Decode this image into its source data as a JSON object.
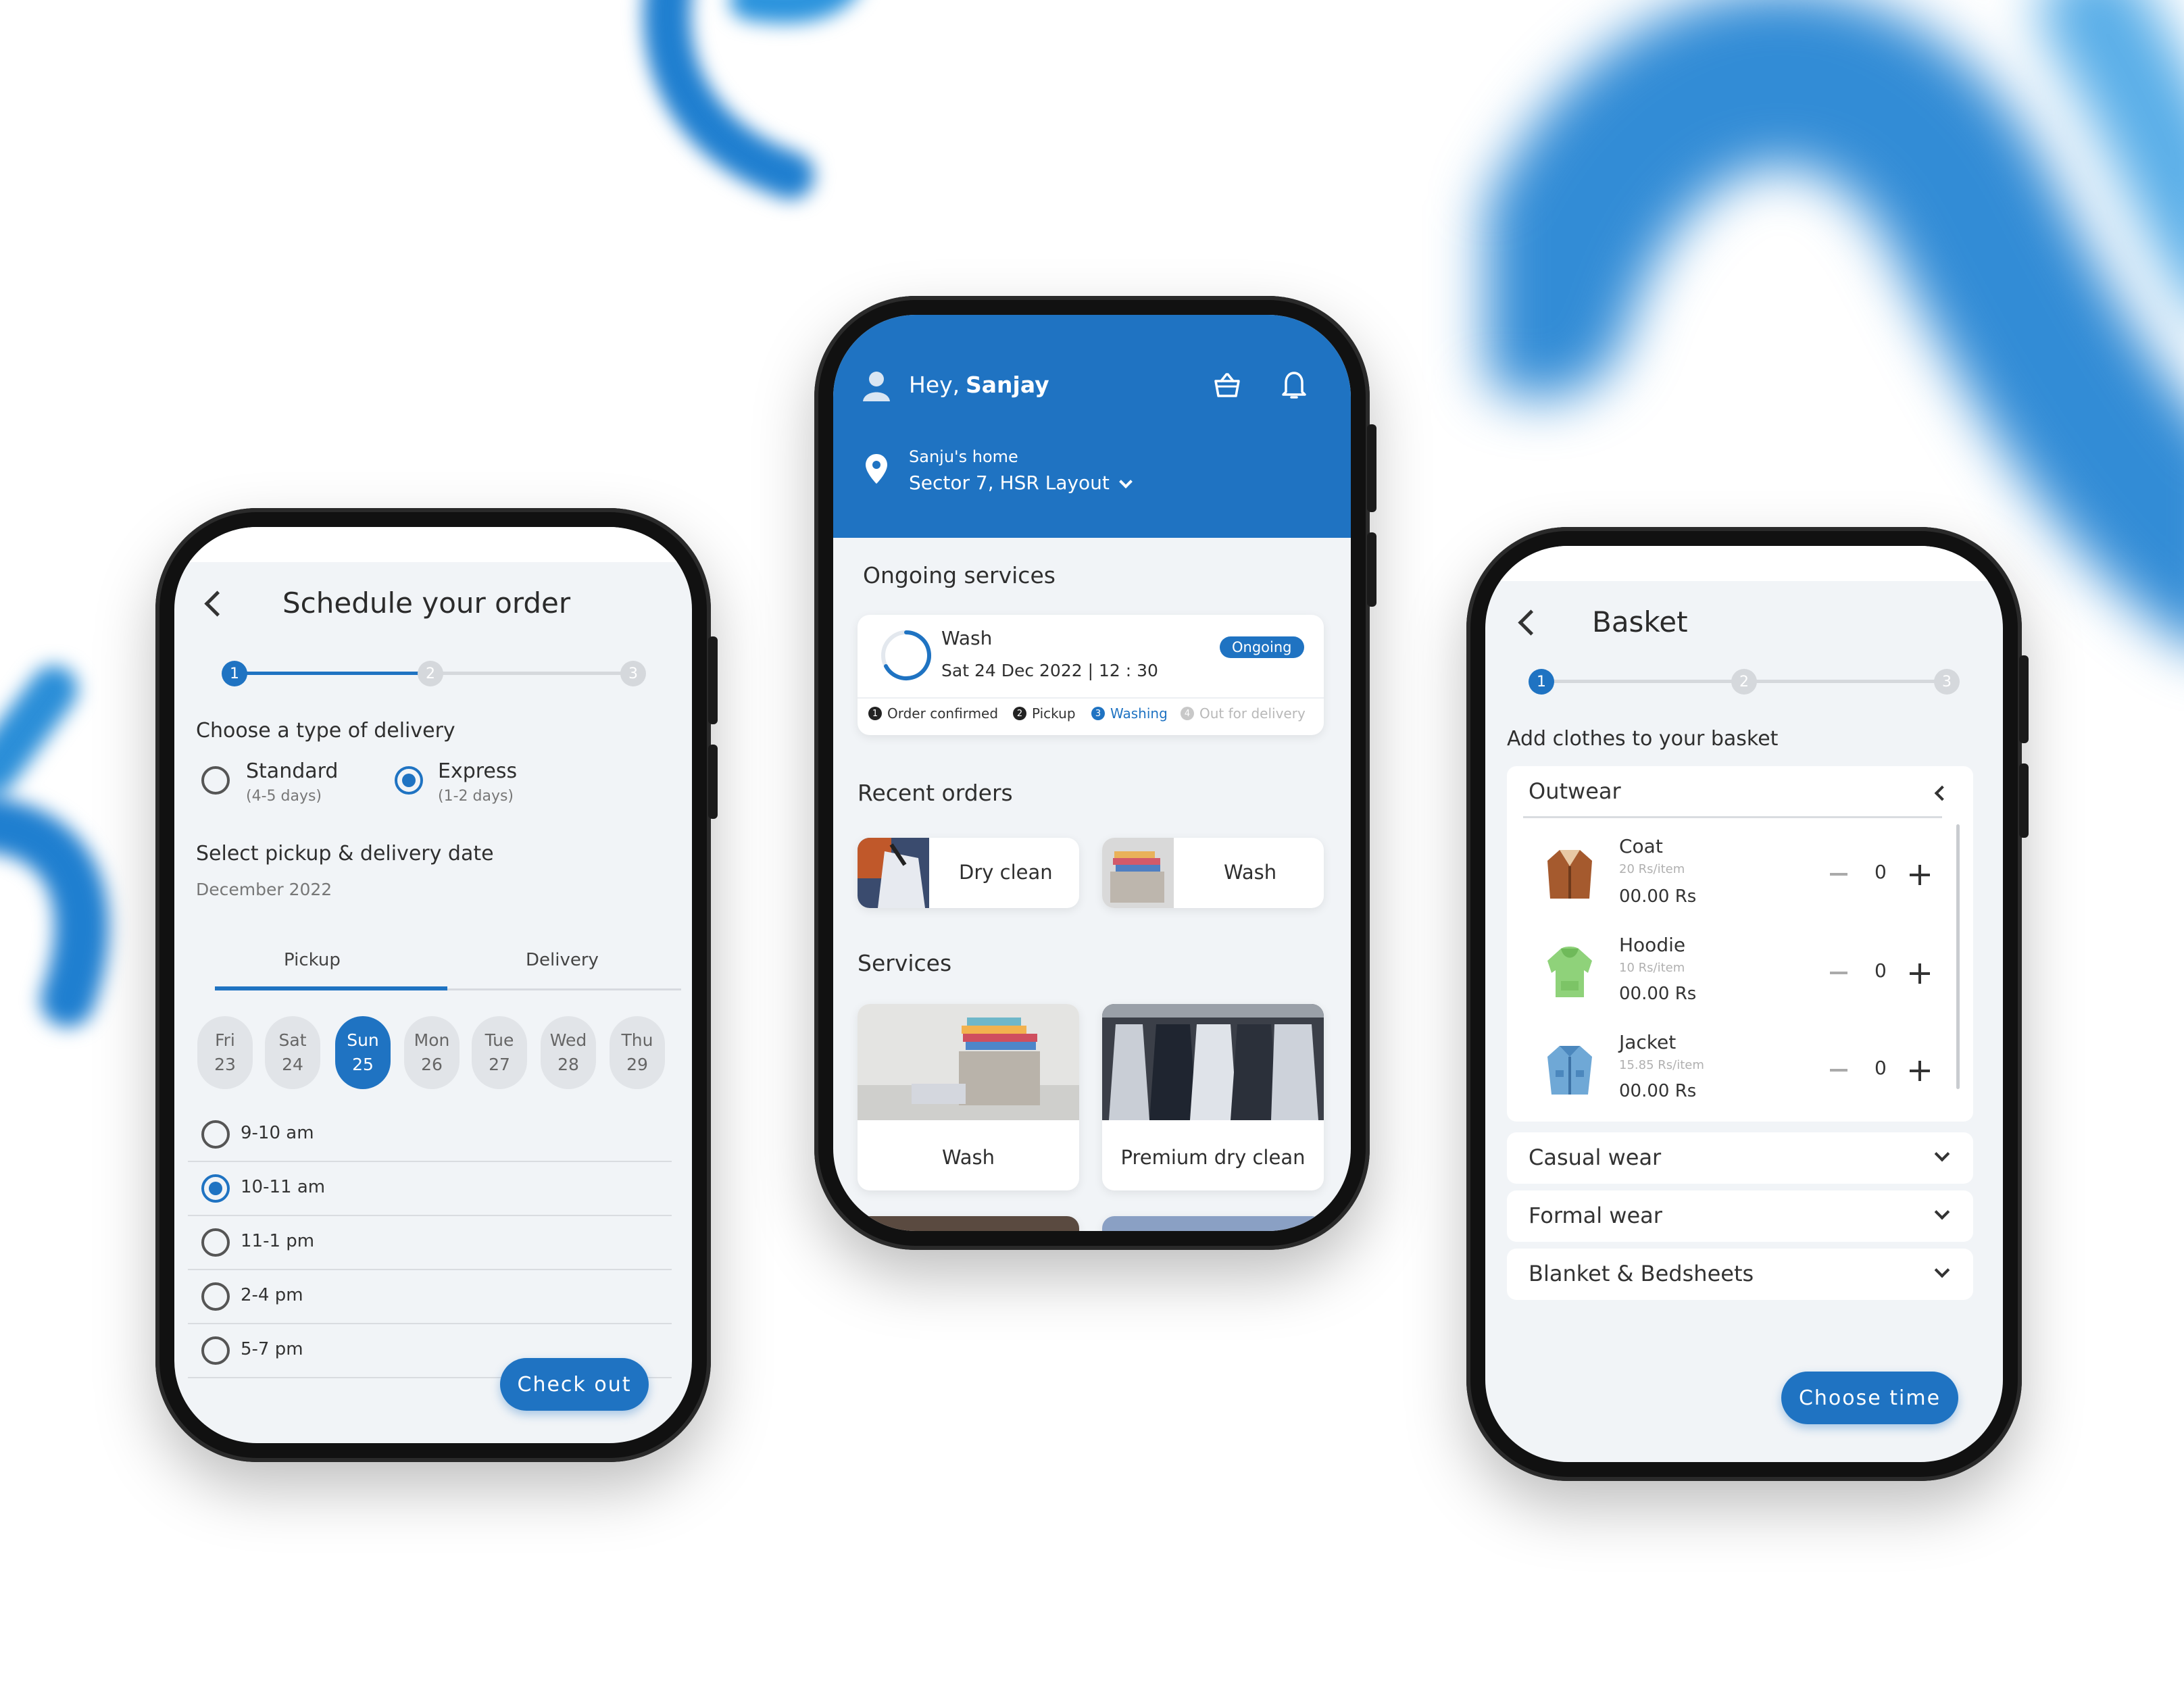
{
  "colors": {
    "accent": "#1f73c2",
    "screen_bg": "#f1f4f7"
  },
  "schedule": {
    "title": "Schedule your order",
    "steps": [
      "1",
      "2",
      "3"
    ],
    "delivery_heading": "Choose a type of delivery",
    "delivery_types": [
      {
        "label": "Standard",
        "sub": "(4-5 days)",
        "selected": false
      },
      {
        "label": "Express",
        "sub": "(1-2 days)",
        "selected": true
      }
    ],
    "date_heading": "Select pickup & delivery date",
    "month": "December  2022",
    "tabs": [
      "Pickup",
      "Delivery"
    ],
    "days": [
      {
        "dow": "Fri",
        "num": "23"
      },
      {
        "dow": "Sat",
        "num": "24"
      },
      {
        "dow": "Sun",
        "num": "25"
      },
      {
        "dow": "Mon",
        "num": "26"
      },
      {
        "dow": "Tue",
        "num": "27"
      },
      {
        "dow": "Wed",
        "num": "28"
      },
      {
        "dow": "Thu",
        "num": "29"
      }
    ],
    "slots": [
      "9-10 am",
      "10-11 am",
      "11-1 pm",
      "2-4 pm",
      "5-7 pm"
    ],
    "checkout_label": "Check out"
  },
  "home": {
    "greeting": "Hey,",
    "user_name": "Sanjay",
    "location_name": "Sanju's home",
    "location_address": "Sector 7, HSR Layout",
    "ongoing_heading": "Ongoing services",
    "ongoing": {
      "service": "Wash",
      "datetime": "Sat 24 Dec 2022 | 12 : 30",
      "badge": "Ongoing",
      "steps": [
        {
          "num": "1",
          "label": "Order confirmed"
        },
        {
          "num": "2",
          "label": "Pickup"
        },
        {
          "num": "3",
          "label": "Washing"
        },
        {
          "num": "4",
          "label": "Out for delivery"
        }
      ]
    },
    "recent_heading": "Recent orders",
    "recent": [
      "Dry clean",
      "Wash"
    ],
    "services_heading": "Services",
    "services": [
      "Wash",
      "Premium dry clean"
    ]
  },
  "basket": {
    "title": "Basket",
    "steps": [
      "1",
      "2",
      "3"
    ],
    "heading": "Add clothes to your basket",
    "categories": [
      "Outwear",
      "Casual wear",
      "Formal wear",
      "Blanket & Bedsheets"
    ],
    "items": [
      {
        "name": "Coat",
        "rate": "20 Rs/item",
        "qty": "0",
        "price": "00.00 Rs"
      },
      {
        "name": "Hoodie",
        "rate": "10 Rs/item",
        "qty": "0",
        "price": "00.00 Rs"
      },
      {
        "name": "Jacket",
        "rate": "15.85 Rs/item",
        "qty": "0",
        "price": "00.00 Rs"
      }
    ],
    "choose_time_label": "Choose time"
  }
}
